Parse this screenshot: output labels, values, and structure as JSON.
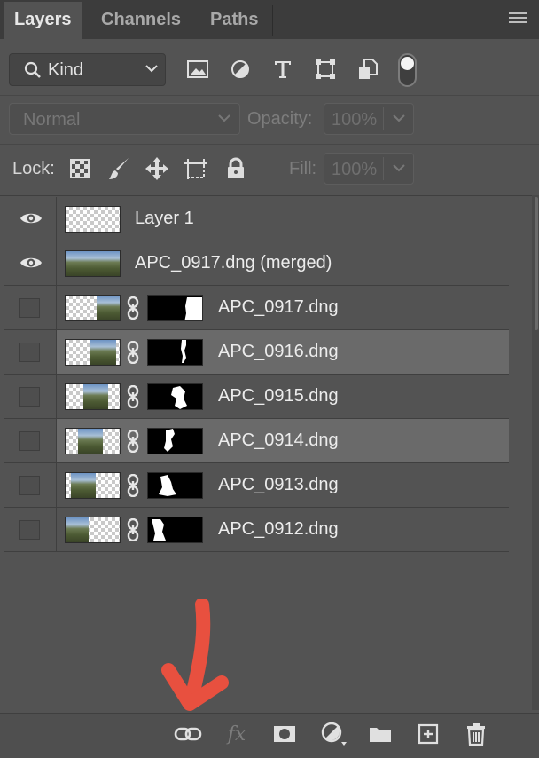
{
  "tabs": [
    {
      "label": "Layers",
      "active": true
    },
    {
      "label": "Channels",
      "active": false
    },
    {
      "label": "Paths",
      "active": false
    }
  ],
  "filter": {
    "kind_label": "Kind",
    "icons": [
      "image-filter-icon",
      "adjustment-filter-icon",
      "type-filter-icon",
      "shape-filter-icon",
      "smart-object-filter-icon"
    ]
  },
  "blend": {
    "mode": "Normal",
    "opacity_label": "Opacity:",
    "opacity_value": "100%"
  },
  "lock": {
    "label": "Lock:",
    "icons": [
      "lock-transparent-pixels-icon",
      "lock-image-pixels-icon",
      "lock-position-icon",
      "lock-artboard-icon",
      "lock-all-icon"
    ],
    "fill_label": "Fill:",
    "fill_value": "100%"
  },
  "layers": [
    {
      "name": "Layer 1",
      "visible": true,
      "selected": false,
      "has_mask": false
    },
    {
      "name": "APC_0917.dng (merged)",
      "visible": true,
      "selected": false,
      "has_mask": false
    },
    {
      "name": "APC_0917.dng",
      "visible": false,
      "selected": false,
      "has_mask": true
    },
    {
      "name": "APC_0916.dng",
      "visible": false,
      "selected": true,
      "has_mask": true
    },
    {
      "name": "APC_0915.dng",
      "visible": false,
      "selected": false,
      "has_mask": true
    },
    {
      "name": "APC_0914.dng",
      "visible": false,
      "selected": true,
      "has_mask": true
    },
    {
      "name": "APC_0913.dng",
      "visible": false,
      "selected": false,
      "has_mask": true
    },
    {
      "name": "APC_0912.dng",
      "visible": false,
      "selected": false,
      "has_mask": true
    }
  ],
  "bottom_toolbar": [
    "link-layers-icon",
    "fx-icon",
    "add-mask-icon",
    "adjustment-layer-icon",
    "group-folder-icon",
    "new-layer-icon",
    "trash-icon"
  ],
  "fx_label": "fx",
  "annotation": {
    "color": "#e8503f",
    "points_to": "link-layers-icon"
  }
}
